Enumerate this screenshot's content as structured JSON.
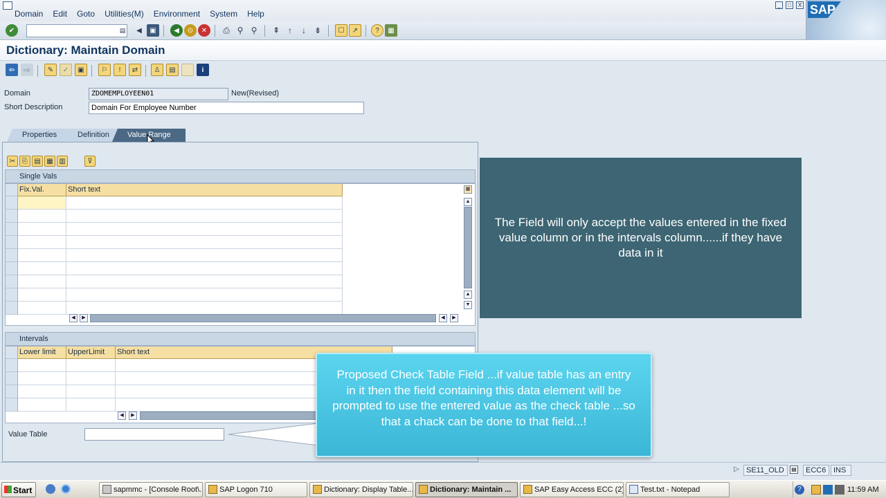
{
  "menu": [
    "Domain",
    "Edit",
    "Goto",
    "Utilities(M)",
    "Environment",
    "System",
    "Help"
  ],
  "window_controls": [
    "_",
    "□",
    "X"
  ],
  "sap_logo": "SAP",
  "title": "Dictionary: Maintain Domain",
  "form": {
    "domain_label": "Domain",
    "domain_value": "ZDOMEMPLOYEEN01",
    "domain_status": "New(Revised)",
    "short_desc_label": "Short Description",
    "short_desc_value": "Domain For Employee Number"
  },
  "tabs": [
    {
      "label": "Properties",
      "active": false
    },
    {
      "label": "Definition",
      "active": false
    },
    {
      "label": "Value Range",
      "active": true
    }
  ],
  "single_vals": {
    "title": "Single Vals",
    "columns": [
      "Fix.Val.",
      "Short text"
    ]
  },
  "intervals": {
    "title": "Intervals",
    "columns": [
      "Lower limit",
      "UpperLimit",
      "Short text"
    ]
  },
  "value_table_label": "Value Table",
  "callouts": {
    "top": "The Field will only accept the values entered in the fixed value column or in the intervals column......if they have data in it",
    "bottom": "Proposed Check Table Field ...if value table has an entry in it then the field containing this data element will be prompted to use the entered value as the check table ...so that a chack can be done to that field...!"
  },
  "status": {
    "transaction": "SE11_OLD",
    "system": "ECC6",
    "mode": "INS"
  },
  "taskbar": {
    "start": "Start",
    "items": [
      {
        "label": "sapmmc - [Console Root\\...",
        "active": false
      },
      {
        "label": "SAP Logon 710",
        "active": false
      },
      {
        "label": "Dictionary: Display Table...",
        "active": false
      },
      {
        "label": "Dictionary: Maintain ...",
        "active": true
      },
      {
        "label": "SAP Easy Access ECC (2)",
        "active": false
      },
      {
        "label": "Test.txt - Notepad",
        "active": false
      }
    ],
    "clock": "11:59 AM"
  },
  "colors": {
    "callout_top": "#3d6573",
    "callout_bottom": "#3bb6d6",
    "column_header": "#f5dfa3",
    "title_text": "#10345e"
  }
}
